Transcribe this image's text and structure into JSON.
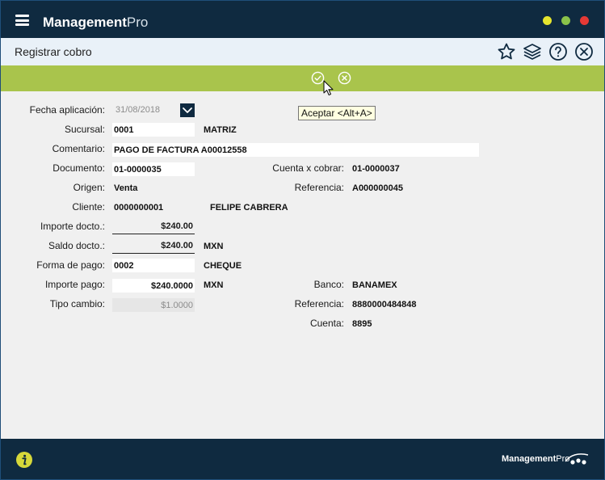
{
  "app": {
    "brand_bold": "Management",
    "brand_light": "Pro",
    "window_colors": {
      "minimize": "#e5e52e",
      "maximize": "#8bc34a",
      "close": "#e53935"
    }
  },
  "header": {
    "title": "Registrar cobro",
    "icons": [
      "star-icon",
      "layers-icon",
      "help-icon",
      "close-icon"
    ]
  },
  "actions": {
    "accept_icon": "check-circle-icon",
    "cancel_icon": "cancel-circle-icon",
    "tooltip": "Aceptar <Alt+A>"
  },
  "form": {
    "fecha_label": "Fecha aplicación:",
    "fecha_value": "31/08/2018",
    "sucursal_label": "Sucursal:",
    "sucursal_value": "0001",
    "sucursal_name": "MATRIZ",
    "comentario_label": "Comentario:",
    "comentario_value": "PAGO DE FACTURA A00012558",
    "documento_label": "Documento:",
    "documento_value": "01-0000035",
    "cuenta_cobrar_label": "Cuenta x cobrar:",
    "cuenta_cobrar_value": "01-0000037",
    "origen_label": "Origen:",
    "origen_value": "Venta",
    "referencia_label": "Referencia:",
    "referencia_value": "A000000045",
    "cliente_label": "Cliente:",
    "cliente_value": "0000000001",
    "cliente_name": "FELIPE CABRERA",
    "importe_docto_label": "Importe docto.:",
    "importe_docto_value": "$240.00",
    "saldo_docto_label": "Saldo docto.:",
    "saldo_docto_value": "$240.00",
    "saldo_currency": "MXN",
    "forma_pago_label": "Forma de pago:",
    "forma_pago_value": "0002",
    "forma_pago_name": "CHEQUE",
    "importe_pago_label": "Importe pago:",
    "importe_pago_value": "$240.0000",
    "importe_currency": "MXN",
    "banco_label": "Banco:",
    "banco_value": "BANAMEX",
    "tipo_cambio_label": "Tipo cambio:",
    "tipo_cambio_value": "$1.0000",
    "referencia2_label": "Referencia:",
    "referencia2_value": "8880000484848",
    "cuenta_label": "Cuenta:",
    "cuenta_value": "8895"
  },
  "footer": {
    "info_icon": "info-icon",
    "brand_bold": "Management",
    "brand_light": "Pro"
  }
}
